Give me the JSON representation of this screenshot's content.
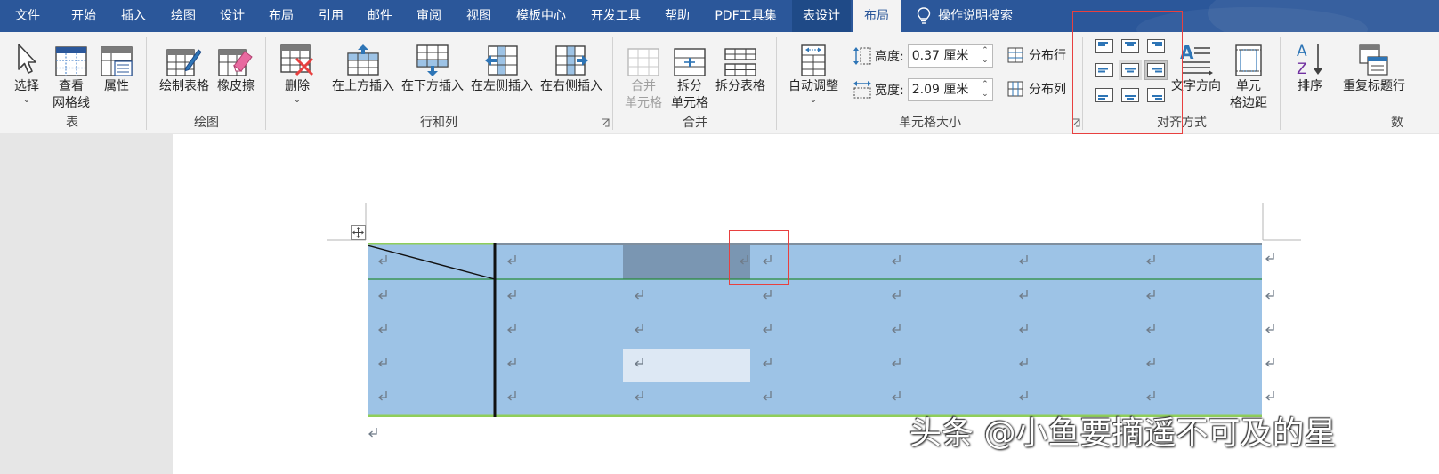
{
  "tabs": [
    {
      "label": "文件",
      "state": "normal"
    },
    {
      "label": "开始",
      "state": "normal"
    },
    {
      "label": "插入",
      "state": "normal"
    },
    {
      "label": "绘图",
      "state": "normal"
    },
    {
      "label": "设计",
      "state": "normal"
    },
    {
      "label": "布局",
      "state": "normal"
    },
    {
      "label": "引用",
      "state": "normal"
    },
    {
      "label": "邮件",
      "state": "normal"
    },
    {
      "label": "审阅",
      "state": "normal"
    },
    {
      "label": "视图",
      "state": "normal"
    },
    {
      "label": "模板中心",
      "state": "normal"
    },
    {
      "label": "开发工具",
      "state": "normal"
    },
    {
      "label": "帮助",
      "state": "normal"
    },
    {
      "label": "PDF工具集",
      "state": "normal"
    },
    {
      "label": "表设计",
      "state": "contextual"
    },
    {
      "label": "布局",
      "state": "active"
    }
  ],
  "search": {
    "label": "操作说明搜索",
    "icon": "lightbulb-icon"
  },
  "ribbon": {
    "table": {
      "label": "表",
      "select": "选择",
      "gridlines_line1": "查看",
      "gridlines_line2": "网格线",
      "properties": "属性"
    },
    "draw": {
      "label": "绘图",
      "draw_table": "绘制表格",
      "eraser": "橡皮擦"
    },
    "rows_cols": {
      "label": "行和列",
      "delete": "删除",
      "insert_above": "在上方插入",
      "insert_below": "在下方插入",
      "insert_left": "在左侧插入",
      "insert_right": "在右侧插入"
    },
    "merge": {
      "label": "合并",
      "merge_cells_line1": "合并",
      "merge_cells_line2": "单元格",
      "split_cells_line1": "拆分",
      "split_cells_line2": "单元格",
      "split_table": "拆分表格"
    },
    "cell_size": {
      "label": "单元格大小",
      "autofit": "自动调整",
      "height_label": "高度:",
      "height_value": "0.37 厘米",
      "width_label": "宽度:",
      "width_value": "2.09 厘米",
      "distribute_rows": "分布行",
      "distribute_cols": "分布列"
    },
    "alignment": {
      "label": "对齐方式",
      "text_direction": "文字方向",
      "cell_margins_line1": "单元",
      "cell_margins_line2": "格边距"
    },
    "data": {
      "label": "数",
      "sort": "排序",
      "repeat_header": "重复标题行"
    }
  },
  "colors": {
    "tabbar": "#2b579a",
    "ribbon": "#f3f3f3",
    "cell_selected": "#9dc3e6",
    "cell_dark": "#7a96b2",
    "cell_light": "#dde8f4",
    "highlight": "#e8403f"
  },
  "watermark": "头条 @小鱼要摘遥不可及的星"
}
